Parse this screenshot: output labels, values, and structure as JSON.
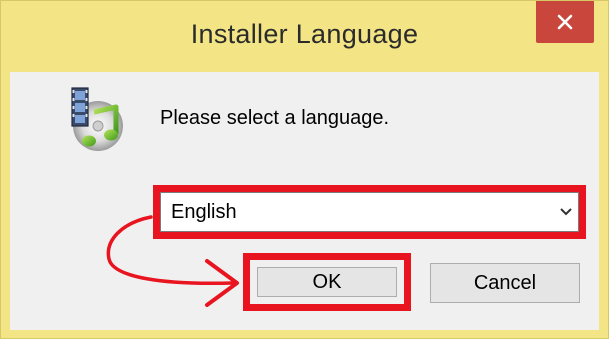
{
  "window": {
    "title": "Installer Language",
    "close_glyph": "✕",
    "background_color": "#f3e585"
  },
  "dialog": {
    "app_icon": "media-installer-icon",
    "prompt": "Please select a language.",
    "language_select": {
      "selected": "English",
      "arrow_icon": "chevron-down-icon"
    },
    "ok_label": "OK",
    "cancel_label": "Cancel"
  },
  "annotations": {
    "highlight_color": "#e8141f",
    "arrow": "curved-arrow-from-select-to-ok"
  }
}
